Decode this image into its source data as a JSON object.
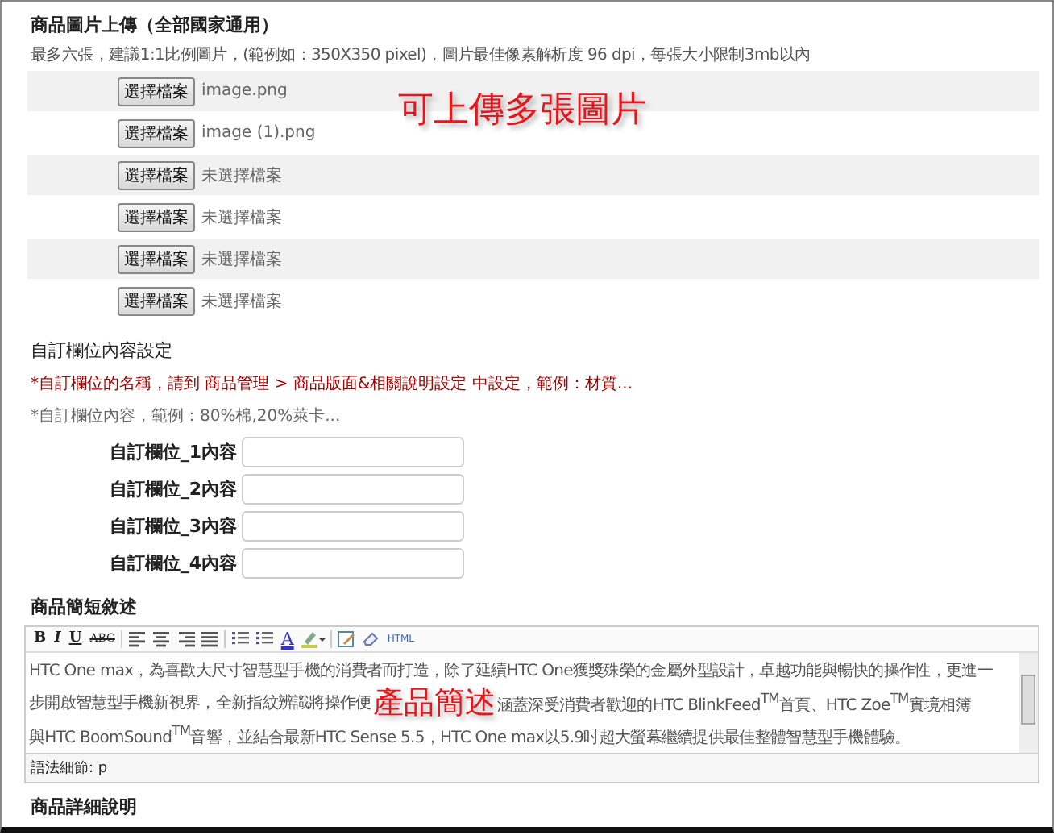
{
  "image_upload": {
    "title": "商品圖片上傳（全部國家通用）",
    "hint": "最多六張，建議1:1比例圖片，(範例如：350X350 pixel)，圖片最佳像素解析度 96 dpi，每張大小限制3mb以內",
    "annotation": "可上傳多張圖片",
    "files": [
      {
        "button": "選擇檔案",
        "filename": "image.png"
      },
      {
        "button": "選擇檔案",
        "filename": "image (1).png"
      },
      {
        "button": "選擇檔案",
        "filename": "未選擇檔案"
      },
      {
        "button": "選擇檔案",
        "filename": "未選擇檔案"
      },
      {
        "button": "選擇檔案",
        "filename": "未選擇檔案"
      },
      {
        "button": "選擇檔案",
        "filename": "未選擇檔案"
      }
    ]
  },
  "custom_fields": {
    "title": "自訂欄位內容設定",
    "warning": "*自訂欄位的名稱，請到 商品管理 > 商品版面&相關說明設定 中設定，範例：材質...",
    "note": "*自訂欄位內容，範例：80%棉,20%萊卡...",
    "fields": [
      {
        "label": "自訂欄位_1內容"
      },
      {
        "label": "自訂欄位_2內容"
      },
      {
        "label": "自訂欄位_3內容"
      },
      {
        "label": "自訂欄位_4內容"
      }
    ]
  },
  "short_description": {
    "title": "商品簡短敘述",
    "toolbar": [
      {
        "kind": "bold",
        "label": "B"
      },
      {
        "kind": "italic",
        "label": "I"
      },
      {
        "kind": "underline",
        "label": "U"
      },
      {
        "kind": "strike",
        "label": "ABC"
      },
      {
        "kind": "separator"
      },
      {
        "kind": "align-left"
      },
      {
        "kind": "align-center"
      },
      {
        "kind": "align-right"
      },
      {
        "kind": "justify"
      },
      {
        "kind": "separator"
      },
      {
        "kind": "bullet-list"
      },
      {
        "kind": "number-list"
      },
      {
        "kind": "text-color",
        "label": "A"
      },
      {
        "kind": "highlight"
      },
      {
        "kind": "separator"
      },
      {
        "kind": "edit"
      },
      {
        "kind": "eraser"
      },
      {
        "kind": "html",
        "label": "HTML"
      }
    ],
    "line_1": "HTC One max，為喜歡大尺寸智慧型手機的消費者而打造，除了延續HTC One獲獎殊榮的金屬外型設計，卓越功能與暢快的操作性，更進一",
    "line_2_before": "步開啟智慧型手機新視界，全新指紋辨識將操作便",
    "annotation": "產品簡述",
    "line_2_after": "涵蓋深受消費者歡迎的HTC BlinkFeed$^{TM}$首頁、HTC Zoe$^{TM}$實境相簿",
    "line_3": "與HTC BoomSound$^{TM}$音響，並結合最新HTC Sense 5.5，HTC One max以5.9吋超大螢幕繼續提供最佳整體智慧型手機體驗。",
    "path": "語法細節: p"
  },
  "detail_description": {
    "title": "商品詳細說明"
  }
}
